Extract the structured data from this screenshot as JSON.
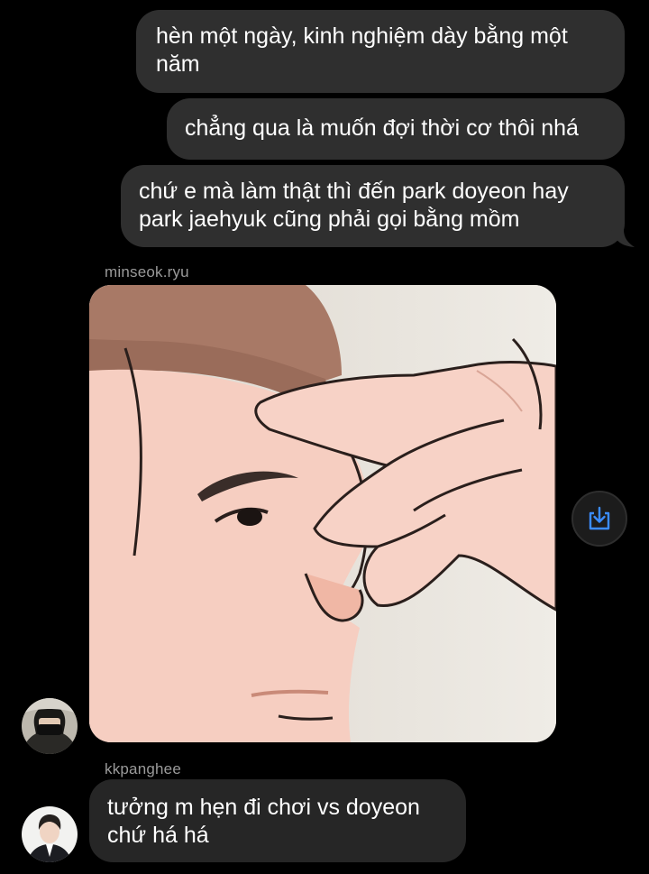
{
  "messages": [
    {
      "id": "m1",
      "direction": "outgoing",
      "text": "hèn một ngày, kinh nghiệm dày bằng một năm"
    },
    {
      "id": "m2",
      "direction": "outgoing",
      "text": "chẳng qua là muốn đợi thời cơ thôi nhá"
    },
    {
      "id": "m3",
      "direction": "outgoing",
      "text": "chứ e mà làm thật thì đến park doyeon hay park jaehyuk cũng phải gọi bằng mồm"
    }
  ],
  "incoming": [
    {
      "sender": "minseok.ryu",
      "type": "image",
      "image_desc": "cartoon man pinching nose bridge"
    },
    {
      "sender": "kkpanghee",
      "type": "text",
      "text": "tưởng m hẹn đi chơi vs doyeon chứ há há"
    }
  ],
  "icons": {
    "save": "download-icon"
  },
  "colors": {
    "background": "#000000",
    "bubble": "#262626",
    "accent": "#3b8cff",
    "sender_text": "#9a9a9a"
  }
}
